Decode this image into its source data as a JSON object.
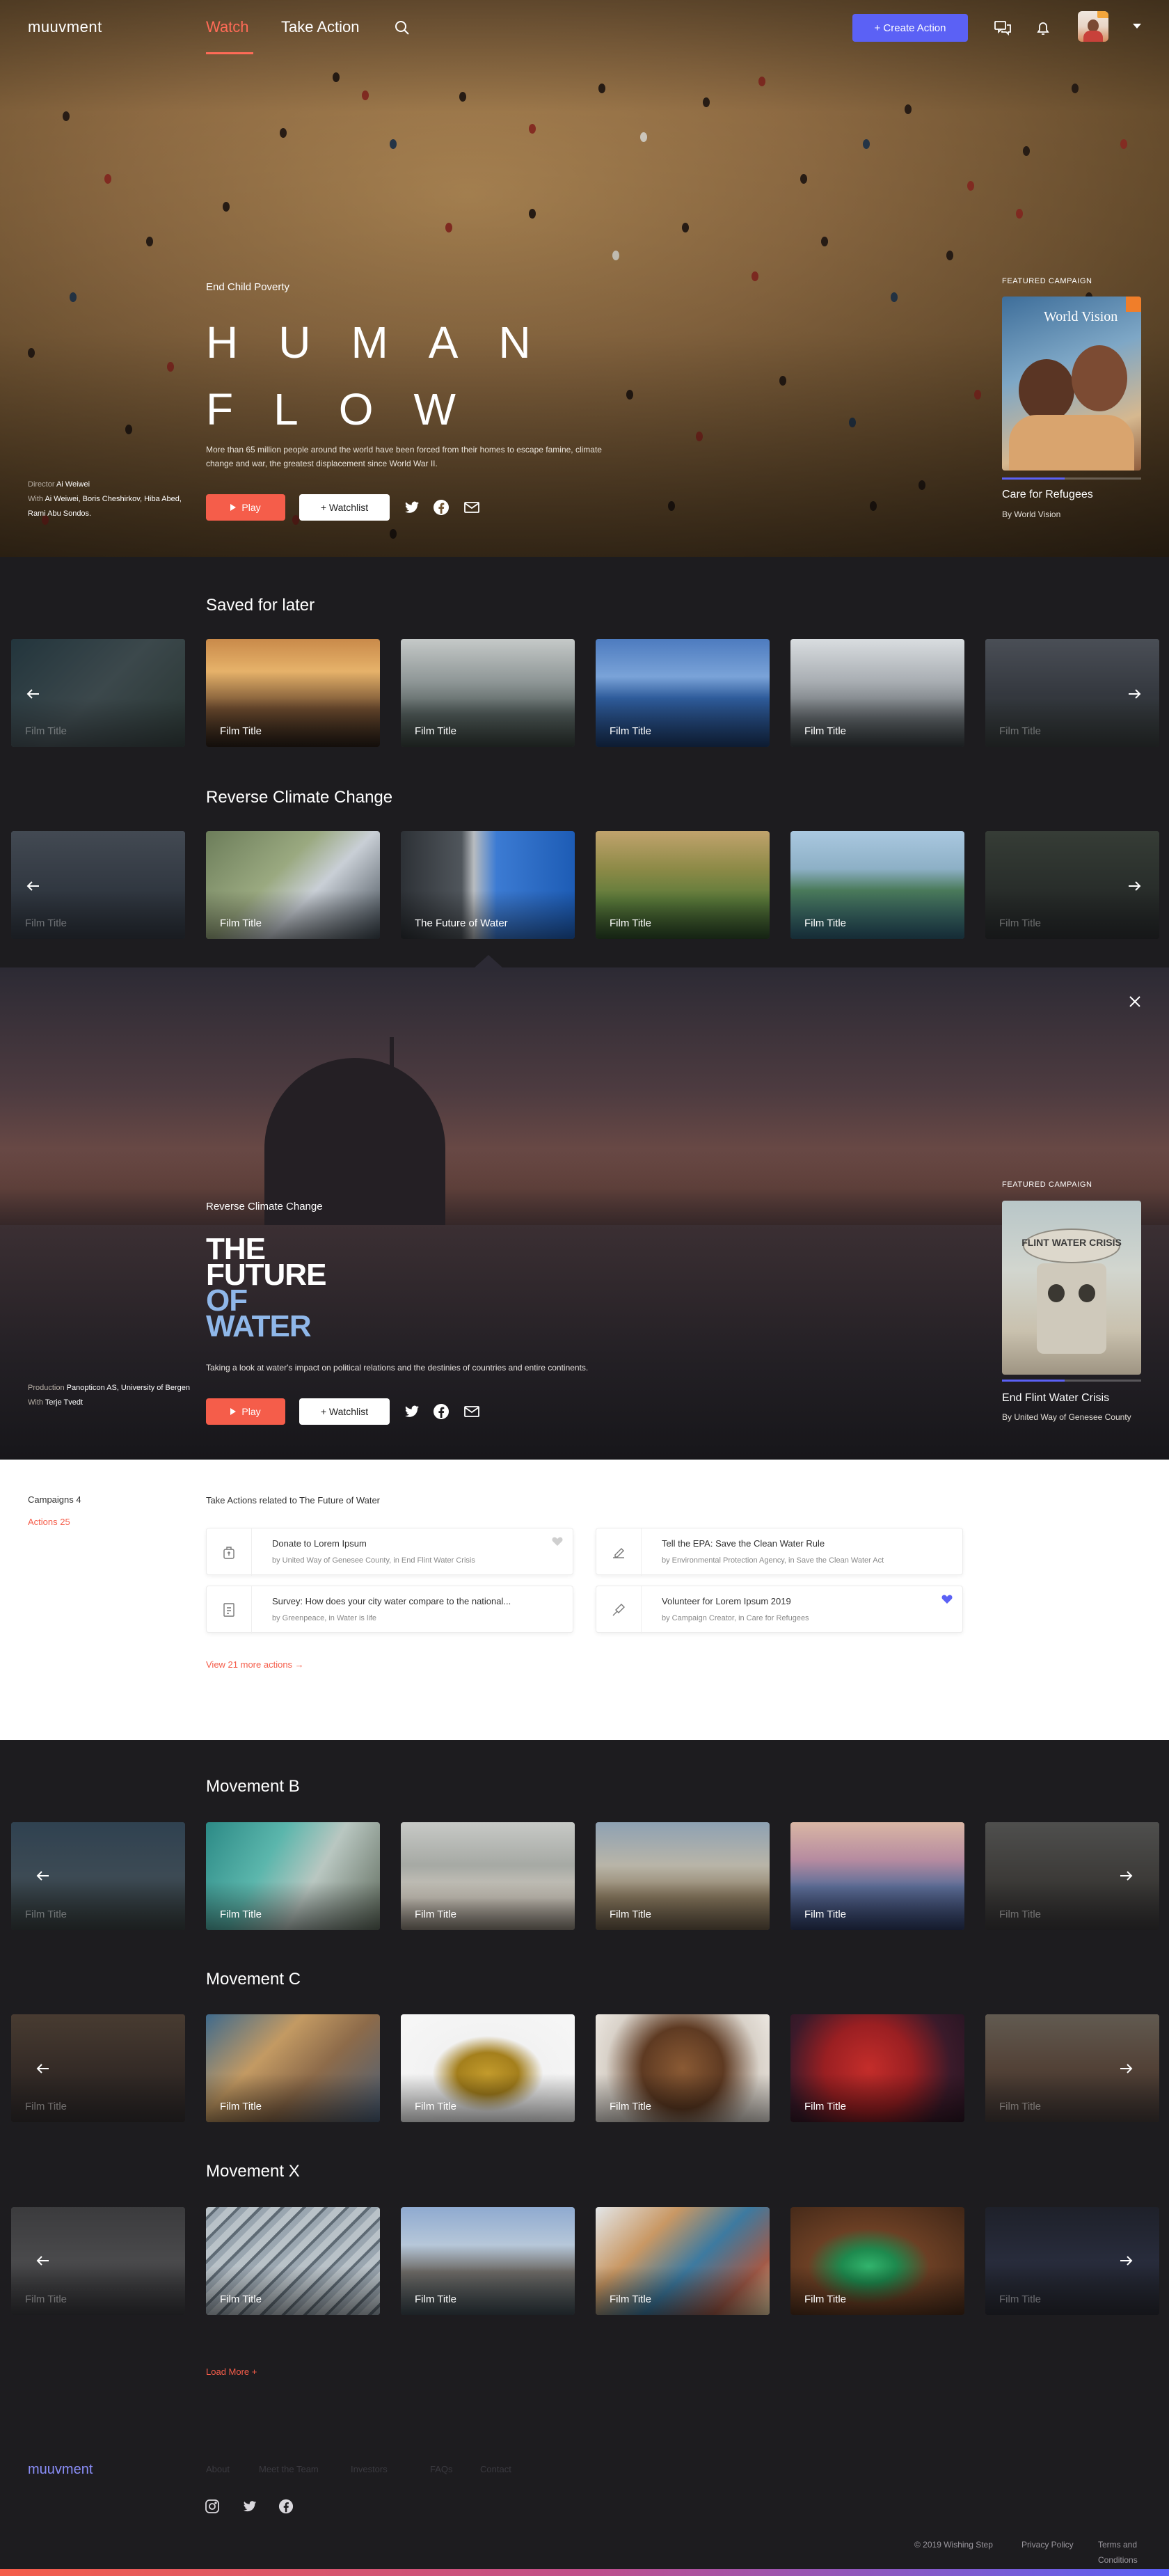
{
  "nav": {
    "logo": "muuvment",
    "watch": "Watch",
    "take_action": "Take Action",
    "create_action": "+ Create Action",
    "icons": [
      "search-icon",
      "chat-icon",
      "bell-icon",
      "avatar",
      "chevron-down-icon"
    ]
  },
  "hero": {
    "kicker": "End Child Poverty",
    "title": "HUMAN FLOW",
    "description": "More than 65 million people around the world have been forced from their homes to escape famine, climate change and war, the greatest displacement since World War II.",
    "play": "Play",
    "watchlist": "+ Watchlist",
    "credits": {
      "director_label": "Director",
      "director": "Ai Weiwei",
      "with_label": "With",
      "cast": "Ai Weiwei, Boris Cheshirkov, Hiba Abed, Rami Abu Sondos."
    },
    "featured": {
      "label": "FEATURED CAMPAIGN",
      "brand": "World Vision",
      "title": "Care for Refugees",
      "by": "By World Vision",
      "progress": 0.45
    }
  },
  "rows": [
    {
      "title": "Saved for later",
      "cards": [
        "Film Title",
        "Film Title",
        "Film Title",
        "Film Title",
        "Film Title",
        "Film Title"
      ]
    },
    {
      "title": "Reverse Climate Change",
      "cards": [
        "Film Title",
        "Film Title",
        "The Future of Water",
        "Film Title",
        "Film Title",
        "Film Title"
      ]
    },
    {
      "title": "Movement B",
      "cards": [
        "Film Title",
        "Film Title",
        "Film Title",
        "Film Title",
        "Film Title",
        "Film Title"
      ]
    },
    {
      "title": "Movement C",
      "cards": [
        "Film Title",
        "Film Title",
        "Film Title",
        "Film Title",
        "Film Title",
        "Film Title"
      ]
    },
    {
      "title": "Movement X",
      "cards": [
        "Film Title",
        "Film Title",
        "Film Title",
        "Film Title",
        "Film Title",
        "Film Title"
      ]
    }
  ],
  "detail": {
    "kicker": "Reverse Climate Change",
    "title_lines": [
      "THE",
      "FUTURE",
      "OF",
      "WATER"
    ],
    "description": "Taking a look at water's impact on political relations and the destinies of countries and entire continents.",
    "play": "Play",
    "watchlist": "+ Watchlist",
    "credits": {
      "production_label": "Production",
      "production": "Panopticon AS, University of Bergen",
      "with_label": "With",
      "cast": "Terje Tvedt"
    },
    "featured": {
      "label": "FEATURED CAMPAIGN",
      "image_text": "FLINT WATER CRISIS",
      "title": "End Flint Water Crisis",
      "by": "By United Way of Genesee County",
      "progress": 0.45
    }
  },
  "actions": {
    "campaigns": "Campaigns  4",
    "actions_count": "Actions  25",
    "heading": "Take Actions related to The Future of Water",
    "items": [
      {
        "title": "Donate to Lorem Ipsum",
        "by": "by United Way of Genesee County,",
        "in": "in End Flint Water Crisis",
        "icon": "donate-icon",
        "liked": false
      },
      {
        "title": "Tell the EPA: Save the Clean Water Rule",
        "by": "by Environmental Protection Agency,",
        "in": "in Save the Clean Water Act",
        "icon": "petition-icon",
        "liked": null
      },
      {
        "title": "Survey: How does your city water compare to the national...",
        "by": "by Greenpeace,",
        "in": "in Water is life",
        "icon": "survey-icon",
        "liked": null
      },
      {
        "title": "Volunteer for Lorem Ipsum 2019",
        "by": "by Campaign Creator,",
        "in": "in Care for Refugees",
        "icon": "volunteer-icon",
        "liked": true
      }
    ],
    "more": "View 21 more actions →"
  },
  "load_more": "Load More +",
  "footer": {
    "logo": "muuvment",
    "links": [
      "About",
      "Meet the Team",
      "Investors",
      "FAQs",
      "Contact"
    ],
    "copyright": "© 2019 Wishing Step",
    "privacy": "Privacy Policy",
    "terms": "Terms and Conditions"
  },
  "colors": {
    "accent": "#ff6b57",
    "primary": "#5b61f5",
    "background": "#1d1c1f"
  }
}
